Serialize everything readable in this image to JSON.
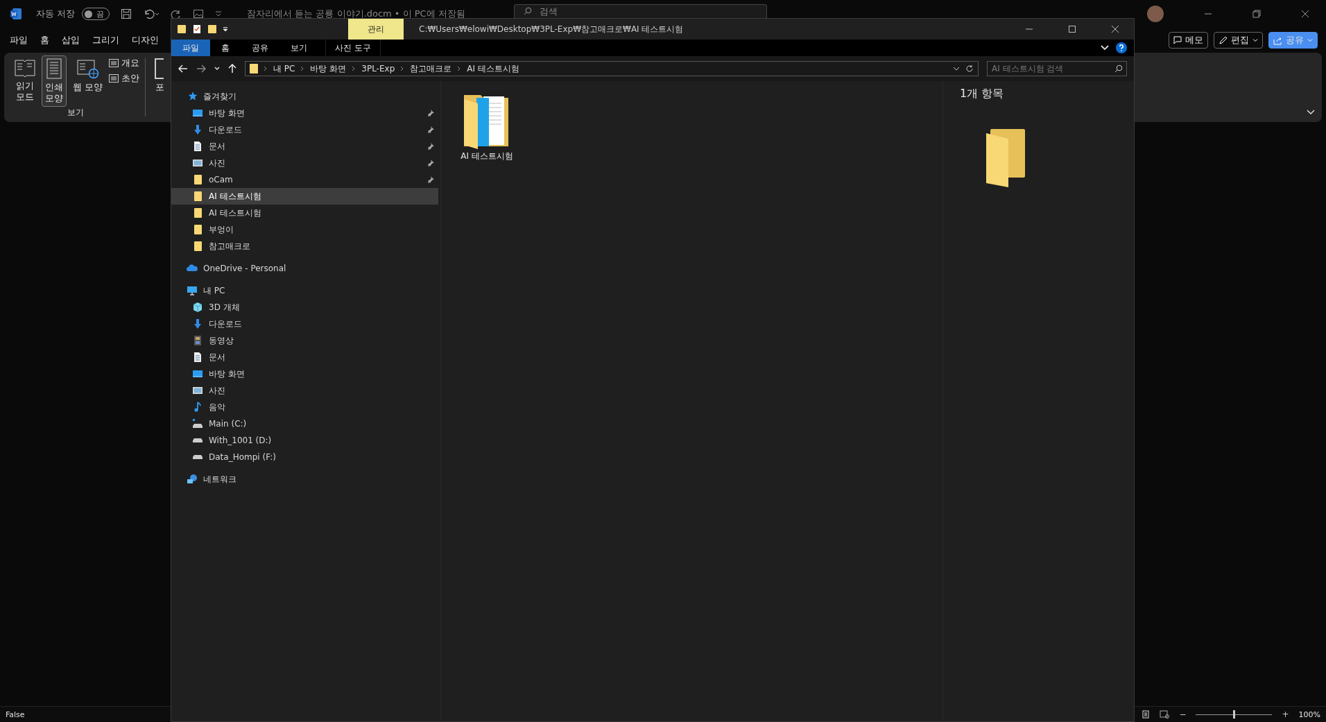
{
  "word": {
    "autosave_label": "자동 저장",
    "autosave_toggle": {
      "on": false,
      "label": "끔"
    },
    "title": "잠자리에서 듣는 공룡 이야기.docm • 이 PC에 저장됨",
    "search": {
      "placeholder": "검색"
    },
    "menu": [
      {
        "label": "파일",
        "selected": false
      },
      {
        "label": "홈",
        "selected": false
      },
      {
        "label": "삽입",
        "selected": false
      },
      {
        "label": "그리기",
        "selected": false
      },
      {
        "label": "디자인",
        "selected": false
      }
    ],
    "actions": [
      {
        "label": "메모",
        "kind": "memo"
      },
      {
        "label": "편집",
        "kind": "edit"
      },
      {
        "label": "공유",
        "kind": "share"
      }
    ],
    "ribbon": {
      "group_label": "보기",
      "buttons": [
        {
          "label": "읽기\n모드",
          "kind": "read",
          "selected": false
        },
        {
          "label": "인쇄\n모양",
          "kind": "print",
          "selected": true
        },
        {
          "label": "웹 모양",
          "kind": "web",
          "selected": false
        }
      ],
      "small_buttons": [
        {
          "label": "개요"
        },
        {
          "label": "초안"
        }
      ],
      "cut_label": "포"
    },
    "status": {
      "text": "False",
      "zoom": {
        "minus": "−",
        "plus": "+",
        "level": 0.5,
        "text": "100%"
      }
    }
  },
  "explorer": {
    "context_tab": "관리",
    "path": "C:₩Users₩elowi₩Desktop₩3PL-Exp₩참고매크로₩AI 테스트시험",
    "tabs": [
      {
        "label": "파일",
        "selected": true
      },
      {
        "label": "홈",
        "selected": false
      },
      {
        "label": "공유",
        "selected": false
      },
      {
        "label": "보기",
        "selected": false
      },
      {
        "label": "사진 도구",
        "selected": false
      }
    ],
    "breadcrumbs": [
      "내 PC",
      "바탕 화면",
      "3PL-Exp",
      "참고매크로",
      "AI 테스트시험"
    ],
    "search": {
      "placeholder": "AI 테스트시험 검색"
    },
    "nav": [
      {
        "label": "즐겨찾기",
        "kind": "star",
        "children": [
          {
            "label": "바탕 화면",
            "kind": "desktop",
            "pinned": true,
            "selected": false
          },
          {
            "label": "다운로드",
            "kind": "download",
            "pinned": true,
            "selected": false
          },
          {
            "label": "문서",
            "kind": "document",
            "pinned": true,
            "selected": false
          },
          {
            "label": "사진",
            "kind": "picture",
            "pinned": true,
            "selected": false
          },
          {
            "label": "oCam",
            "kind": "folder",
            "pinned": true,
            "selected": false
          },
          {
            "label": "AI 테스트시험",
            "kind": "folder",
            "pinned": false,
            "selected": true
          },
          {
            "label": "AI 테스트시험",
            "kind": "folder",
            "pinned": false,
            "selected": false
          },
          {
            "label": "부엉이",
            "kind": "folder",
            "pinned": false,
            "selected": false
          },
          {
            "label": "참고매크로",
            "kind": "folder",
            "pinned": false,
            "selected": false
          }
        ]
      },
      {
        "label": "OneDrive - Personal",
        "kind": "cloud"
      },
      {
        "label": "내 PC",
        "kind": "pc",
        "children": [
          {
            "label": "3D 개체",
            "kind": "cube",
            "pinned": false,
            "selected": false
          },
          {
            "label": "다운로드",
            "kind": "download",
            "pinned": false,
            "selected": false
          },
          {
            "label": "동영상",
            "kind": "video",
            "pinned": false,
            "selected": false
          },
          {
            "label": "문서",
            "kind": "document",
            "pinned": false,
            "selected": false
          },
          {
            "label": "바탕 화면",
            "kind": "desktop",
            "pinned": false,
            "selected": false
          },
          {
            "label": "사진",
            "kind": "picture",
            "pinned": false,
            "selected": false
          },
          {
            "label": "음악",
            "kind": "music",
            "pinned": false,
            "selected": false
          },
          {
            "label": "Main (C:)",
            "kind": "system-drive",
            "pinned": false,
            "selected": false
          },
          {
            "label": "With_1001 (D:)",
            "kind": "drive",
            "pinned": false,
            "selected": false
          },
          {
            "label": "Data_Hompi (F:)",
            "kind": "drive",
            "pinned": false,
            "selected": false
          }
        ]
      },
      {
        "label": "네트워크",
        "kind": "network"
      }
    ],
    "files": [
      {
        "label": "AI 테스트시험"
      }
    ],
    "details": {
      "count": "1개 항목"
    }
  }
}
